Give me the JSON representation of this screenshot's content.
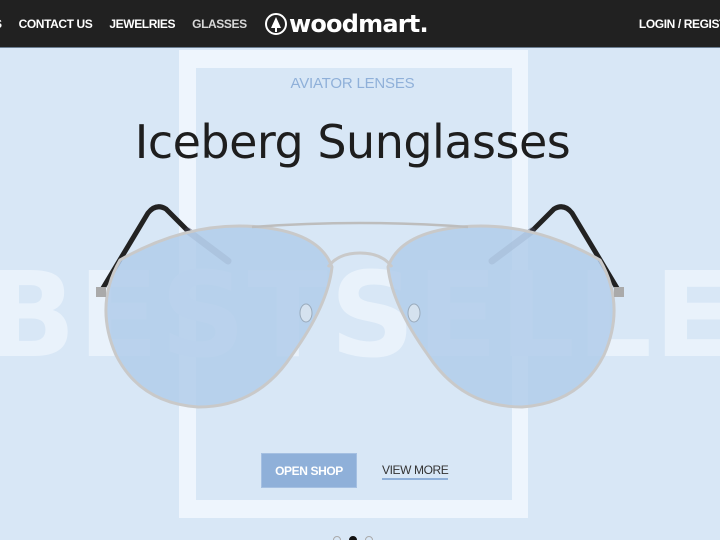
{
  "header": {
    "nav_items": [
      {
        "label": "S"
      },
      {
        "label": "CONTACT US"
      },
      {
        "label": "JEWELRIES"
      },
      {
        "label": "GLASSES"
      }
    ],
    "logo_text": "woodmart.",
    "logo_icon": "tree-icon",
    "login_label": "LOGIN / REGIST"
  },
  "slide": {
    "background_word": "BESTSELLER",
    "subtitle": "AVIATOR LENSES",
    "title": "Iceberg Sunglasses",
    "image_alt": "aviator-sunglasses",
    "primary_button": "OPEN SHOP",
    "secondary_button": "VIEW MORE",
    "accent_color": "#8fb0d9"
  },
  "slider": {
    "dots": 3,
    "active_index": 1
  }
}
